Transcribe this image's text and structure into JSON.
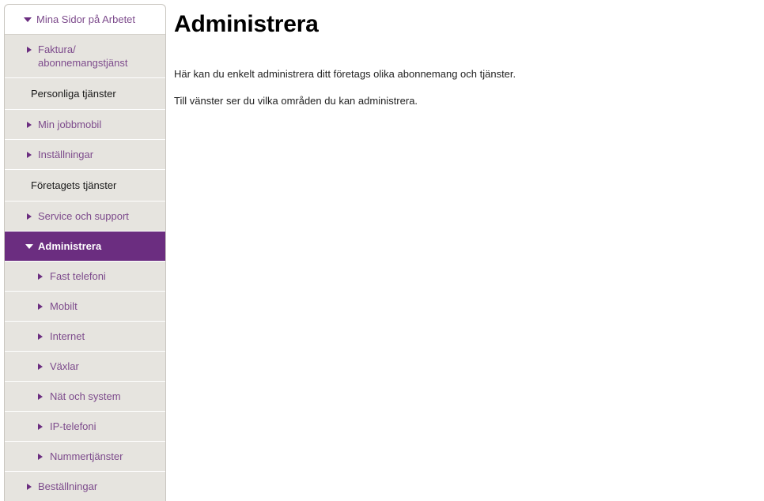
{
  "colors": {
    "accent_purple": "#6b2d80",
    "link_purple": "#7d4b8c",
    "sidebar_bg": "#e6e4df",
    "sidebar_border": "#c9c6c0",
    "page_bg": "#ffffff",
    "heading_text": "#000000",
    "body_text": "#222222"
  },
  "main": {
    "title": "Administrera",
    "paragraphs": [
      "Här kan du enkelt administrera ditt företags olika abonnemang och tjänster.",
      "Till vänster ser du vilka områden du kan administrera."
    ]
  },
  "sidebar": {
    "items": [
      {
        "label": "Mina Sidor på Arbetet",
        "icon": "triangle-down-icon",
        "kind": "portal-header",
        "level": 0,
        "expanded": true,
        "active": false,
        "interactable": true
      },
      {
        "label": "Faktura/ abonnemangstjänst",
        "icon": "triangle-right-icon",
        "kind": "link",
        "level": 1,
        "expanded": false,
        "active": false,
        "interactable": true
      },
      {
        "label": "Personliga tjänster",
        "icon": "none",
        "kind": "section-heading",
        "level": 0,
        "expanded": false,
        "active": false,
        "interactable": false
      },
      {
        "label": "Min jobbmobil",
        "icon": "triangle-right-icon",
        "kind": "link",
        "level": 1,
        "expanded": false,
        "active": false,
        "interactable": true
      },
      {
        "label": "Inställningar",
        "icon": "triangle-right-icon",
        "kind": "link",
        "level": 1,
        "expanded": false,
        "active": false,
        "interactable": true
      },
      {
        "label": "Företagets tjänster",
        "icon": "none",
        "kind": "section-heading",
        "level": 0,
        "expanded": false,
        "active": false,
        "interactable": false
      },
      {
        "label": "Service och support",
        "icon": "triangle-right-icon",
        "kind": "link",
        "level": 1,
        "expanded": false,
        "active": false,
        "interactable": true
      },
      {
        "label": "Administrera",
        "icon": "triangle-down-icon",
        "kind": "link",
        "level": 1,
        "expanded": true,
        "active": true,
        "interactable": true
      },
      {
        "label": "Fast telefoni",
        "icon": "triangle-right-icon",
        "kind": "link",
        "level": 2,
        "expanded": false,
        "active": false,
        "interactable": true
      },
      {
        "label": "Mobilt",
        "icon": "triangle-right-icon",
        "kind": "link",
        "level": 2,
        "expanded": false,
        "active": false,
        "interactable": true
      },
      {
        "label": "Internet",
        "icon": "triangle-right-icon",
        "kind": "link",
        "level": 2,
        "expanded": false,
        "active": false,
        "interactable": true
      },
      {
        "label": "Växlar",
        "icon": "triangle-right-icon",
        "kind": "link",
        "level": 2,
        "expanded": false,
        "active": false,
        "interactable": true
      },
      {
        "label": "Nät och system",
        "icon": "triangle-right-icon",
        "kind": "link",
        "level": 2,
        "expanded": false,
        "active": false,
        "interactable": true
      },
      {
        "label": "IP-telefoni",
        "icon": "triangle-right-icon",
        "kind": "link",
        "level": 2,
        "expanded": false,
        "active": false,
        "interactable": true
      },
      {
        "label": "Nummertjänster",
        "icon": "triangle-right-icon",
        "kind": "link",
        "level": 2,
        "expanded": false,
        "active": false,
        "interactable": true
      },
      {
        "label": "Beställningar",
        "icon": "triangle-right-icon",
        "kind": "link",
        "level": 1,
        "expanded": false,
        "active": false,
        "interactable": true
      }
    ]
  }
}
